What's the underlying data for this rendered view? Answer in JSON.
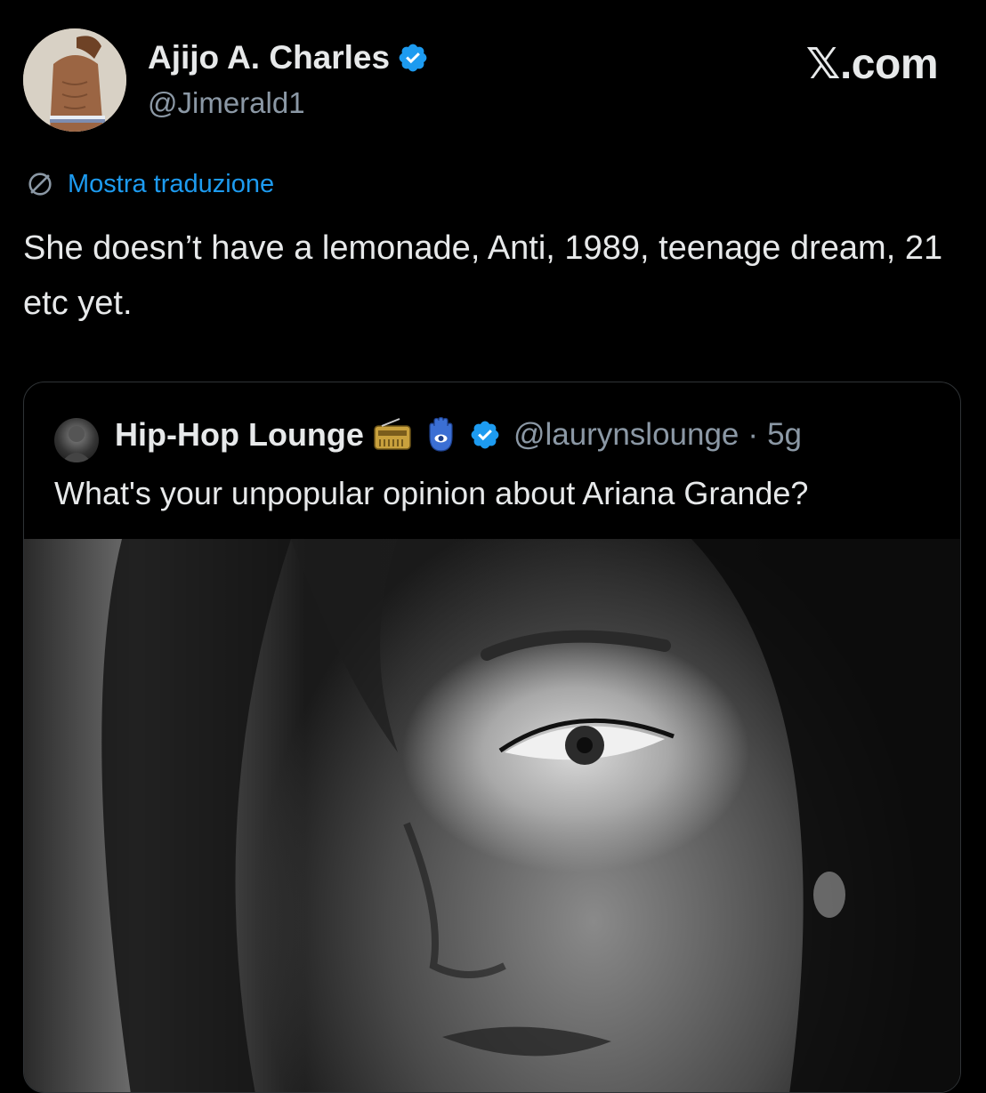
{
  "tweet": {
    "author_name": "Ajijo A. Charles",
    "author_handle": "@Jimerald1",
    "verified": true,
    "translate_label": "Mostra traduzione",
    "text": "She doesn’t have a lemonade, Anti, 1989, teenage dream, 21 etc yet."
  },
  "brand": {
    "label": "𝕏.com"
  },
  "quoted_tweet": {
    "author_name": "Hip-Hop Lounge",
    "emojis": [
      "radio-emoji",
      "hamsa-emoji"
    ],
    "verified": true,
    "author_handle": "@laurynslounge",
    "separator": "·",
    "time": "5g",
    "text": "What's your unpopular opinion about Ariana Grande?",
    "media": {
      "type": "photo",
      "description_icon": "portrait-photo"
    }
  },
  "colors": {
    "background": "#000000",
    "text_primary": "#e7e9ea",
    "text_secondary": "#8b98a5",
    "accent": "#1d9bf0",
    "border": "#2f3336"
  }
}
